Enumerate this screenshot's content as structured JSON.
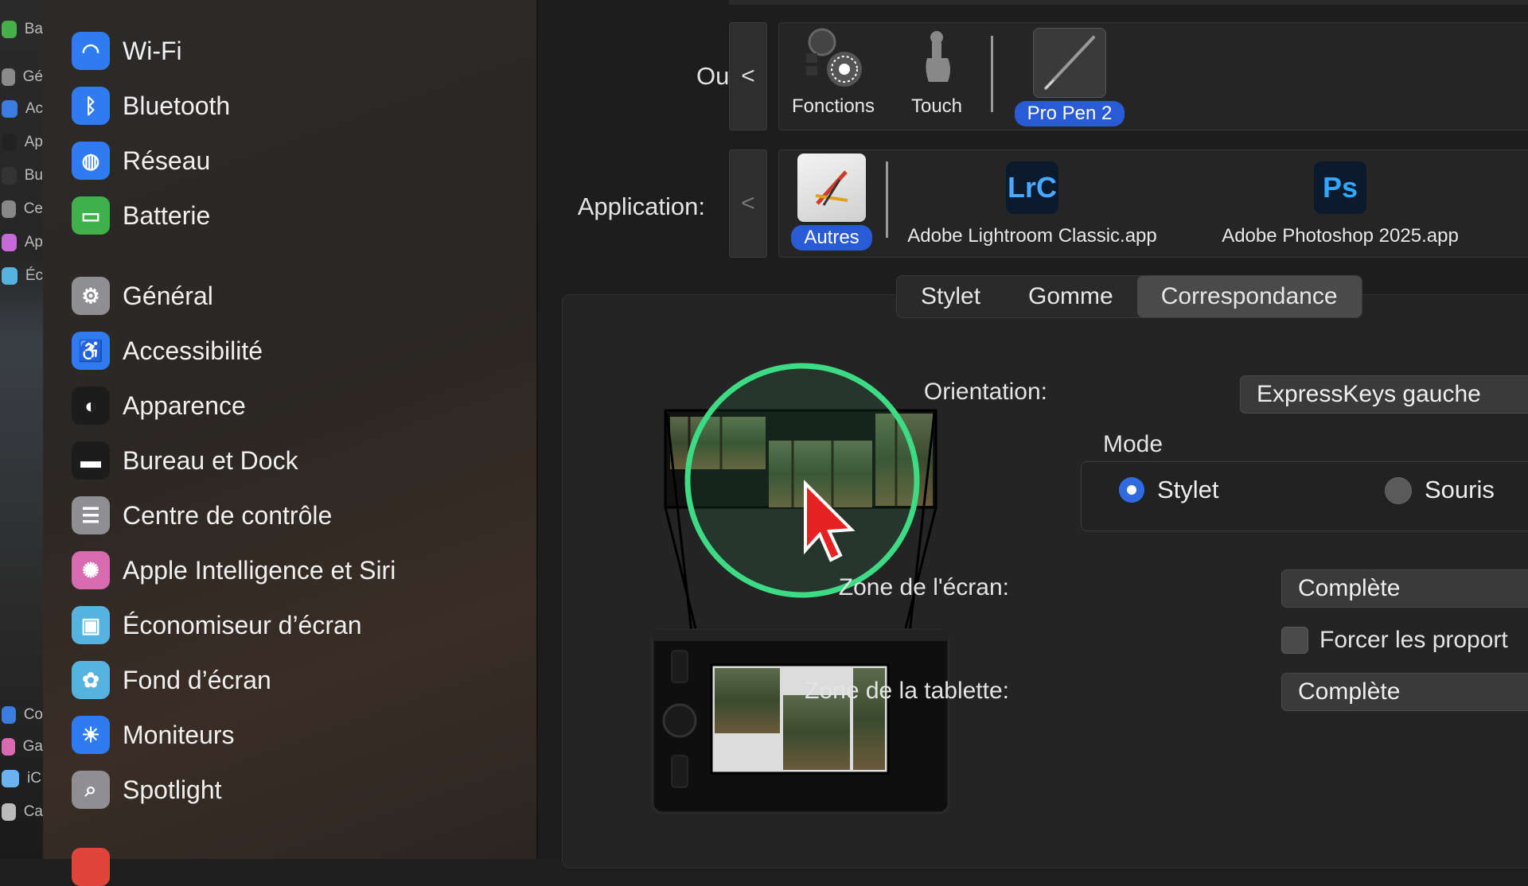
{
  "strip": [
    {
      "label": "Ba",
      "color": "#45b04a"
    },
    {
      "label": "Gé",
      "color": "#8a8a8a"
    },
    {
      "label": "Ac",
      "color": "#3a7ce0"
    },
    {
      "label": "Ap",
      "color": "#222222"
    },
    {
      "label": "Bu",
      "color": "#333333"
    },
    {
      "label": "Ce",
      "color": "#888888"
    },
    {
      "label": "Ap",
      "color": "#c56ad8"
    },
    {
      "label": "Éc",
      "color": "#56b3e0"
    },
    {
      "label": "Co",
      "color": "#3a7ce0"
    },
    {
      "label": "Ga",
      "color": "#d86ab0"
    },
    {
      "label": "iC",
      "color": "#6ab3f0"
    },
    {
      "label": "Ca",
      "color": "#bbbbbb"
    }
  ],
  "sidebar": {
    "items": [
      {
        "label": "Wi-Fi",
        "icon": "wifi-icon",
        "glyph": "◠",
        "color": "#2f7cf0"
      },
      {
        "label": "Bluetooth",
        "icon": "bluetooth-icon",
        "glyph": "ᛒ",
        "color": "#2f7cf0"
      },
      {
        "label": "Réseau",
        "icon": "globe-icon",
        "glyph": "◍",
        "color": "#2f7cf0"
      },
      {
        "label": "Batterie",
        "icon": "battery-icon",
        "glyph": "▭",
        "color": "#3fb14a"
      },
      {
        "label": "Général",
        "icon": "gear-icon",
        "glyph": "⚙",
        "color": "#8e8e93"
      },
      {
        "label": "Accessibilité",
        "icon": "accessibility-icon",
        "glyph": "♿",
        "color": "#2f7cf0"
      },
      {
        "label": "Apparence",
        "icon": "appearance-icon",
        "glyph": "◐",
        "color": "#1c1c1c"
      },
      {
        "label": "Bureau et Dock",
        "icon": "dock-icon",
        "glyph": "▬",
        "color": "#1c1c1c"
      },
      {
        "label": "Centre de contrôle",
        "icon": "control-center-icon",
        "glyph": "☰",
        "color": "#8e8e93"
      },
      {
        "label": "Apple Intelligence et Siri",
        "icon": "siri-icon",
        "glyph": "✺",
        "color": "#d86ab0"
      },
      {
        "label": "Économiseur d’écran",
        "icon": "screensaver-icon",
        "glyph": "▣",
        "color": "#56b3e0"
      },
      {
        "label": "Fond d’écran",
        "icon": "wallpaper-icon",
        "glyph": "✿",
        "color": "#56b3e0"
      },
      {
        "label": "Moniteurs",
        "icon": "displays-icon",
        "glyph": "☀",
        "color": "#2f7cf0"
      },
      {
        "label": "Spotlight",
        "icon": "search-icon",
        "glyph": "⌕",
        "color": "#8e8e93"
      }
    ]
  },
  "tool_row": {
    "label": "Outil :",
    "back": "<",
    "tools": [
      {
        "label": "Fonctions",
        "icon": "functions-icon",
        "selected": false
      },
      {
        "label": "Touch",
        "icon": "touch-icon",
        "selected": false
      },
      {
        "label": "Pro Pen 2",
        "icon": "pen-icon",
        "selected": true
      }
    ]
  },
  "app_row": {
    "label": "Application:",
    "back": "<",
    "apps": [
      {
        "label": "Autres",
        "icon": "others-app-icon",
        "badge": "",
        "selected": true
      },
      {
        "label": "Adobe Lightroom Classic.app",
        "icon": "lightroom-icon",
        "badge": "LrC",
        "selected": false
      },
      {
        "label": "Adobe Photoshop 2025.app",
        "icon": "photoshop-icon",
        "badge": "Ps",
        "selected": false
      }
    ]
  },
  "tabs": [
    {
      "label": "Stylet",
      "selected": false
    },
    {
      "label": "Gomme",
      "selected": false
    },
    {
      "label": "Correspondance",
      "selected": true
    }
  ],
  "mapping": {
    "orientation_label": "Orientation:",
    "orientation_value": "ExpressKeys gauche",
    "mode_label": "Mode",
    "mode_options": [
      {
        "label": "Stylet",
        "selected": true
      },
      {
        "label": "Souris",
        "selected": false
      }
    ],
    "screen_zone_label": "Zone de l'écran:",
    "screen_zone_value": "Complète",
    "force_proportions_label": "Forcer les proport",
    "force_proportions_checked": false,
    "tablet_zone_label": "Zone de la tablette:",
    "tablet_zone_value": "Complète"
  },
  "colors": {
    "accent": "#2a5bd7",
    "highlight_ring": "#3ddc84"
  }
}
